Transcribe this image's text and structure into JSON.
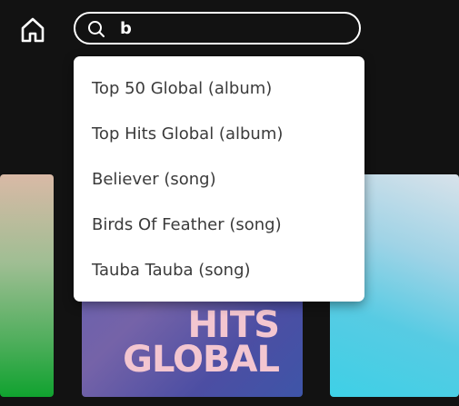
{
  "header": {
    "home_icon": "home-icon",
    "search_icon": "search-icon"
  },
  "search": {
    "value": "b",
    "suggestions": [
      "Top 50 Global (album)",
      "Top Hits Global (album)",
      "Believer (song)",
      "Birds Of Feather (song)",
      "Tauba Tauba (song)"
    ]
  },
  "cards": {
    "middle": {
      "title_line1": "HITS",
      "title_line2": "GLOBAL"
    }
  },
  "colors": {
    "background": "#121212",
    "dropdown_bg": "#ffffff",
    "dropdown_text": "#3b3b3b",
    "middle_card_text": "#f3c6d0"
  }
}
